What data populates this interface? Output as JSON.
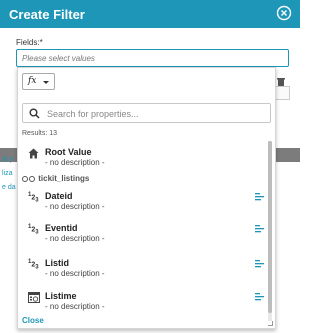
{
  "dialog": {
    "title": "Create Filter"
  },
  "fields": {
    "label": "Fields:*",
    "placeholder": "Please select values"
  },
  "popup": {
    "fx_label": "fx",
    "search_placeholder": "Search for properties...",
    "results": "Results: 13",
    "items": [
      {
        "name": "Root Value",
        "desc": "- no description -",
        "icon": "home-icon"
      },
      {
        "name": "Dateid",
        "desc": "- no description -",
        "icon": "numeric-icon"
      },
      {
        "name": "Eventid",
        "desc": "- no description -",
        "icon": "numeric-icon"
      },
      {
        "name": "Listid",
        "desc": "- no description -",
        "icon": "numeric-icon"
      },
      {
        "name": "Listime",
        "desc": "- no description -",
        "icon": "calendar-icon"
      }
    ],
    "group_label": "tickit_listings",
    "close_label": "Close"
  },
  "colors": {
    "accent": "#1d96b8",
    "overlay": "#7c7c7c"
  }
}
